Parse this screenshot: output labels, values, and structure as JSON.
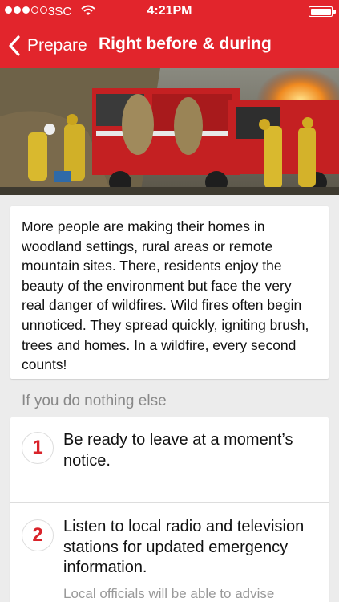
{
  "status_bar": {
    "carrier": "3SC",
    "time": "4:21PM"
  },
  "nav": {
    "back_label": "Prepare",
    "title": "Right before & during"
  },
  "intro": {
    "text": "More people are making their homes in woodland settings, rural areas or remote mountain sites. There, residents enjoy the beauty of the environment but face the very real danger of wildfires. Wild fires often begin unnoticed. They spread quickly, igniting brush, trees and homes. In a wildfire, every second counts!"
  },
  "section": {
    "title": "If you do nothing else"
  },
  "steps": [
    {
      "number": "1",
      "text": "Be ready to leave at a moment’s notice."
    },
    {
      "number": "2",
      "text": "Listen to local radio and television stations for updated emergency information.",
      "subtext": "Local officials will be able to advise"
    }
  ],
  "colors": {
    "brand_red": "#e2252c",
    "step_number": "#d9232a",
    "background": "#ececec"
  }
}
